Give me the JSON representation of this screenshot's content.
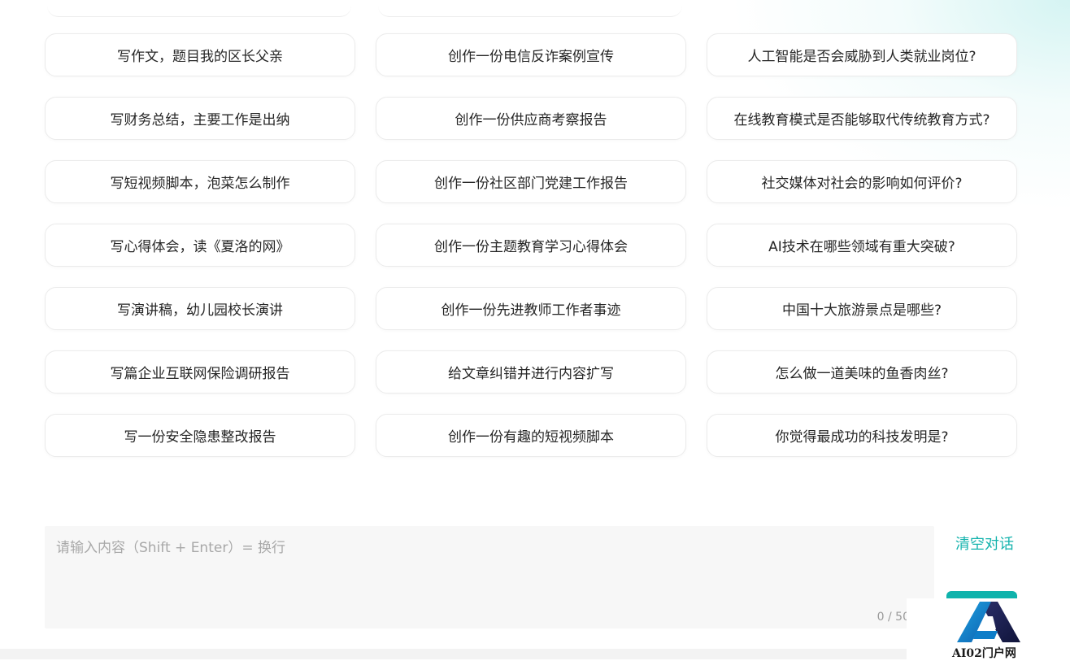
{
  "prompts": [
    "写作文，题目我的区长父亲",
    "创作一份电信反诈案例宣传",
    "人工智能是否会威胁到人类就业岗位?",
    "写财务总结，主要工作是出纳",
    "创作一份供应商考察报告",
    "在线教育模式是否能够取代传统教育方式?",
    "写短视频脚本，泡菜怎么制作",
    "创作一份社区部门党建工作报告",
    "社交媒体对社会的影响如何评价?",
    "写心得体会，读《夏洛的网》",
    "创作一份主题教育学习心得体会",
    "AI技术在哪些领域有重大突破?",
    "写演讲稿，幼儿园校长演讲",
    "创作一份先进教师工作者事迹",
    "中国十大旅游景点是哪些?",
    "写篇企业互联网保险调研报告",
    "给文章纠错并进行内容扩写",
    "怎么做一道美味的鱼香肉丝?",
    "写一份安全隐患整改报告",
    "创作一份有趣的短视频脚本",
    "你觉得最成功的科技发明是?"
  ],
  "input": {
    "placeholder": "请输入内容（Shift + Enter）= 换行",
    "value": "",
    "char_count": "0 / 50"
  },
  "actions": {
    "clear_label": "清空对话"
  },
  "watermark": {
    "text": "AI02门户网"
  },
  "colors": {
    "accent": "#14b3ad",
    "card_border": "#ebebeb",
    "input_bg": "#f7f7f7"
  }
}
